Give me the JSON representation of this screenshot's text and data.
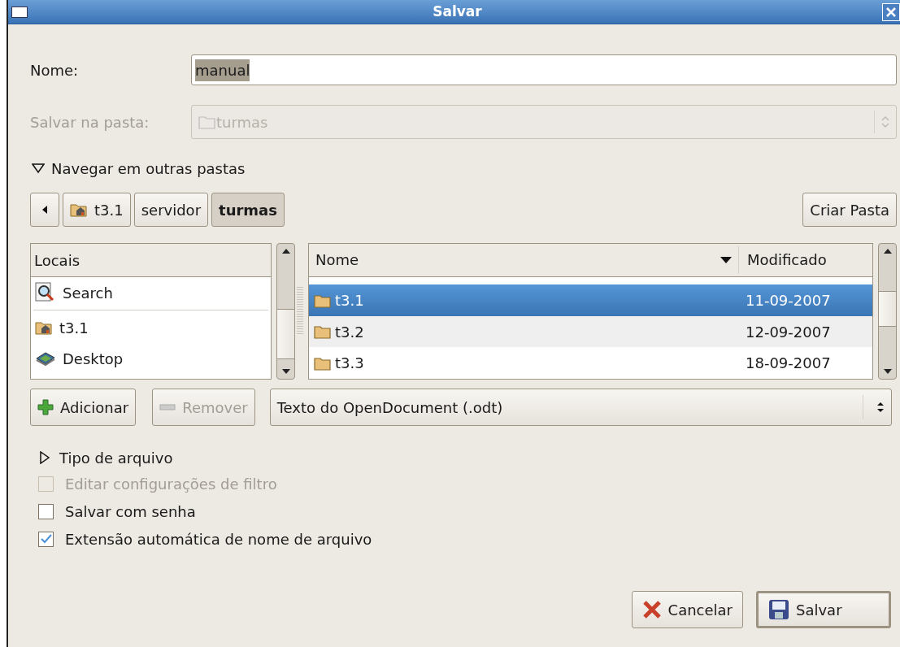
{
  "window": {
    "title": "Salvar"
  },
  "name_field": {
    "label": "Nome:",
    "value": "manual"
  },
  "folder_field": {
    "label": "Salvar na pasta:",
    "value": "turmas",
    "disabled": true
  },
  "browse_toggle": {
    "label": "Navegar em outras pastas",
    "expanded": true
  },
  "path_bar": [
    {
      "label": "t3.1",
      "kind": "home",
      "selected": false
    },
    {
      "label": "servidor",
      "kind": "plain",
      "selected": false
    },
    {
      "label": "turmas",
      "kind": "plain",
      "selected": true
    }
  ],
  "create_folder_button": {
    "label": "Criar Pasta"
  },
  "places": {
    "header": "Locais",
    "items": [
      {
        "label": "Search",
        "kind": "search"
      },
      {
        "label": "t3.1",
        "kind": "home"
      },
      {
        "label": "Desktop",
        "kind": "desktop"
      }
    ]
  },
  "files": {
    "columns": [
      "Nome",
      "Modificado"
    ],
    "rows": [
      {
        "name": "t3.1",
        "modified": "11-09-2007",
        "selected": true
      },
      {
        "name": "t3.2",
        "modified": "12-09-2007",
        "selected": false
      },
      {
        "name": "t3.3",
        "modified": "18-09-2007",
        "selected": false
      }
    ]
  },
  "add_button": {
    "label": "Adicionar"
  },
  "remove_button": {
    "label": "Remover",
    "disabled": true
  },
  "file_type": {
    "value": "Texto do OpenDocument (.odt)"
  },
  "type_toggle": {
    "label": "Tipo de arquivo",
    "expanded": false
  },
  "options": [
    {
      "label": "Editar configurações de filtro",
      "checked": false,
      "disabled": true
    },
    {
      "label": "Salvar com senha",
      "checked": false,
      "disabled": false
    },
    {
      "label": "Extensão automática de nome de arquivo",
      "checked": true,
      "disabled": false
    }
  ],
  "buttons": [
    {
      "label": "Cancelar",
      "kind": "cancel"
    },
    {
      "label": "Salvar",
      "kind": "save"
    }
  ]
}
